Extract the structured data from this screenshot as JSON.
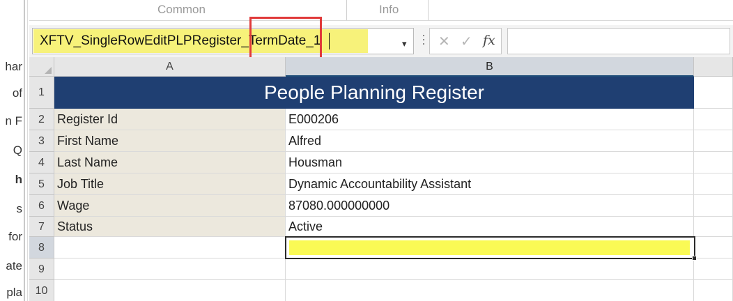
{
  "left_panel": {
    "fragments": [
      "har",
      "of",
      "n F",
      "Q",
      "h",
      "s",
      "for",
      "ate",
      "pla"
    ]
  },
  "ribbon": {
    "group_common": "Common",
    "group_info": "Info"
  },
  "formula_bar": {
    "name_box_value": "XFTV_SingleRowEditPLPRegister_TermDate_1",
    "dropdown_icon": "▾",
    "cancel_icon": "✕",
    "enter_icon": "✓",
    "function_icon": "fx",
    "formula_value": "",
    "highlight_color": "#f7f27a",
    "callout_color": "#e03a3a"
  },
  "sheet": {
    "columns": [
      "A",
      "B"
    ],
    "title": "People Planning Register",
    "title_color": "#1f3f72",
    "rows": [
      {
        "num": "1"
      },
      {
        "num": "2",
        "label": "Register Id",
        "value": "E000206"
      },
      {
        "num": "3",
        "label": "First Name",
        "value": "Alfred"
      },
      {
        "num": "4",
        "label": "Last Name",
        "value": "Housman"
      },
      {
        "num": "5",
        "label": "Job Title",
        "value": "Dynamic Accountability Assistant"
      },
      {
        "num": "6",
        "label": "Wage",
        "value": "87080.000000000"
      },
      {
        "num": "7",
        "label": "Status",
        "value": "Active"
      },
      {
        "num": "8",
        "label": "",
        "value": ""
      },
      {
        "num": "9"
      },
      {
        "num": "10"
      }
    ],
    "active_cell": "B8",
    "active_fill_color": "#fafa55",
    "label_fill_color": "#ece8dd"
  }
}
